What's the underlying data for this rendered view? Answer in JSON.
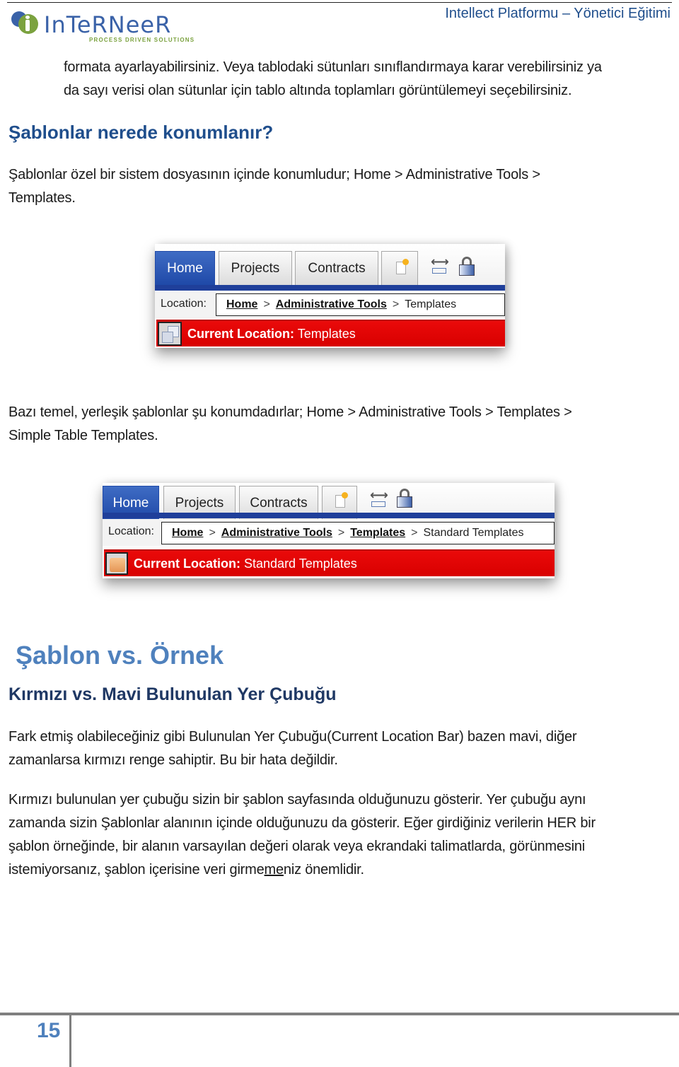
{
  "header": {
    "logo_name": "InTeRNeeR",
    "logo_tagline": "PROCESS DRIVEN SOLUTIONS",
    "title": "Intellect Platformu – Yönetici Eğitimi"
  },
  "content": {
    "intro_line1": "formata ayarlayabilirsiniz. Veya tablodaki sütunları sınıflandırmaya karar verebilirsiniz ya",
    "intro_line2": "da sayı verisi olan sütunlar için  tablo  altında toplamları görüntülemeyi seçebilirsiniz.",
    "heading_where": "Şablonlar nerede konumlanır?",
    "para_where_line1": "Şablonlar özel bir sistem dosyasının içinde konumludur; Home > Administrative Tools >",
    "para_where_line2": "Templates.",
    "para_builtin_line1": "Bazı temel, yerleşik şablonlar şu konumdadırlar; Home > Administrative Tools > Templates >",
    "para_builtin_line2": "Simple Table Templates.",
    "heading_template_vs_instance": "Şablon vs. Örnek",
    "heading_red_vs_blue": "Kırmızı vs. Mavi Bulunulan Yer Çubuğu",
    "para_bar_line1": "Fark etmiş olabileceğiniz gibi Bulunulan Yer Çubuğu(Current Location Bar) bazen mavi, diğer",
    "para_bar_line2": "zamanlarsa kırmızı renge sahiptir. Bu bir hata değildir.",
    "para_red_line1": "Kırmızı bulunulan yer çubuğu sizin bir şablon sayfasında olduğunuzu gösterir. Yer çubuğu aynı",
    "para_red_line2": "zamanda sizin Şablonlar alanının içinde olduğunuzu da gösterir. Eğer girdiğiniz verilerin HER bir",
    "para_red_line3": "şablon örneğinde, bir alanın varsayılan değeri olarak veya ekrandaki talimatlarda, görünmesini",
    "para_red_line4_pre": "istemiyorsanız, şablon içerisine veri girme",
    "para_red_line4_u": "me",
    "para_red_line4_post": "niz önemlidir."
  },
  "screenshot1": {
    "tabs": [
      "Home",
      "Projects",
      "Contracts"
    ],
    "active_tab": "Home",
    "icons": [
      "new-document-icon",
      "resize-icon",
      "lock-icon"
    ],
    "location_label": "Location:",
    "breadcrumb": [
      "Home",
      "Administrative Tools"
    ],
    "breadcrumb_current": "Templates",
    "separator": ">",
    "current_label": "Current Location:",
    "current_value": "Templates",
    "bar_color": "#e00000",
    "bar_icon": "templates-icon"
  },
  "screenshot2": {
    "tabs": [
      "Home",
      "Projects",
      "Contracts"
    ],
    "active_tab": "Home",
    "icons": [
      "new-document-icon",
      "resize-icon",
      "lock-icon"
    ],
    "location_label": "Location:",
    "breadcrumb": [
      "Home",
      "Administrative Tools",
      "Templates"
    ],
    "breadcrumb_current": "Standard Templates",
    "separator": ">",
    "current_label": "Current Location:",
    "current_value": "Standard Templates",
    "bar_color": "#e00000",
    "bar_icon": "folder-icon"
  },
  "footer": {
    "page_number": "15"
  }
}
